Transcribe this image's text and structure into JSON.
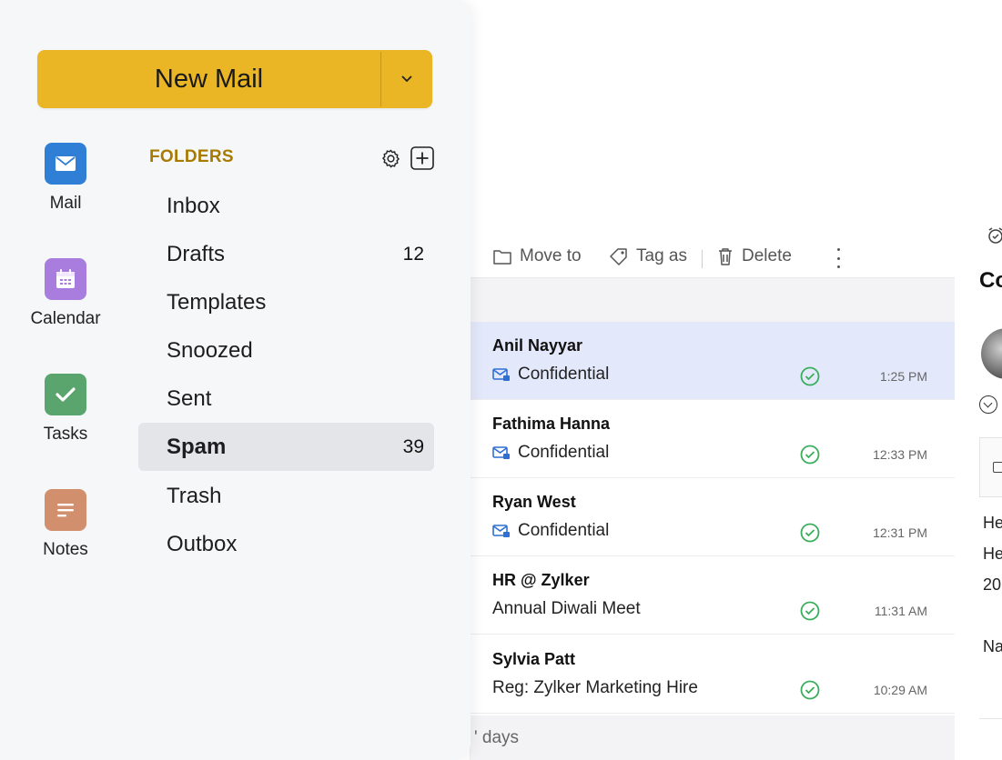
{
  "sidebar": {
    "new_mail_label": "New Mail",
    "apps": [
      {
        "label": "Mail",
        "icon": "mail-icon",
        "color": "#2f7fd6"
      },
      {
        "label": "Calendar",
        "icon": "calendar-icon",
        "color": "#a87dde"
      },
      {
        "label": "Tasks",
        "icon": "check-icon",
        "color": "#5aa56e"
      },
      {
        "label": "Notes",
        "icon": "notes-icon",
        "color": "#d18f6d"
      }
    ],
    "folders_title": "FOLDERS",
    "folders": [
      {
        "name": "Inbox",
        "count": ""
      },
      {
        "name": "Drafts",
        "count": "12"
      },
      {
        "name": "Templates",
        "count": ""
      },
      {
        "name": "Snoozed",
        "count": ""
      },
      {
        "name": "Sent",
        "count": ""
      },
      {
        "name": "Spam",
        "count": "39",
        "active": true
      },
      {
        "name": "Trash",
        "count": ""
      },
      {
        "name": "Outbox",
        "count": ""
      }
    ]
  },
  "toolbar": {
    "move_to": "Move to",
    "tag_as": "Tag as",
    "delete": "Delete"
  },
  "messages": [
    {
      "sender": "Anil Nayyar",
      "subject": "Confidential",
      "encrypted": true,
      "time": "1:25 PM",
      "selected": true
    },
    {
      "sender": "Fathima Hanna",
      "subject": "Confidential",
      "encrypted": true,
      "time": "12:33 PM"
    },
    {
      "sender": "Ryan West",
      "subject": "Confidential",
      "encrypted": true,
      "time": "12:31 PM"
    },
    {
      "sender": "HR @ Zylker",
      "subject": "Annual Diwali Meet",
      "encrypted": false,
      "time": "11:31 AM"
    },
    {
      "sender": "Sylvia Patt",
      "subject": "Reg: Zylker Marketing Hire",
      "encrypted": false,
      "time": "10:29 AM"
    }
  ],
  "list_footer": {
    "group_label": "' days"
  },
  "reading_pane": {
    "subject_fragment": "Co",
    "lines": [
      "He",
      "He",
      "20",
      "Na"
    ]
  },
  "colors": {
    "accent": "#ebb625",
    "folders_title": "#a87a00",
    "selected_row": "#e3e8fb",
    "check": "#3aae5c",
    "encrypted_icon": "#2f6fd1"
  }
}
